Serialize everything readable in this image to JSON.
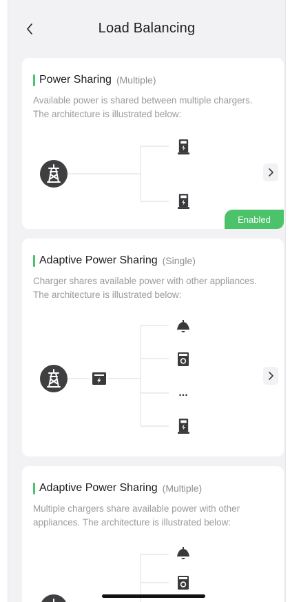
{
  "header": {
    "title": "Load Balancing",
    "back_icon": "chevron-left-icon"
  },
  "accent_color": "#4cc36b",
  "cards": [
    {
      "title": "Power Sharing",
      "subtitle": "(Multiple)",
      "description": "Available power is shared between multiple chargers. The architecture is illustrated below:",
      "status_badge": "Enabled",
      "diagram_nodes": [
        "power-tower-icon",
        "ev-charger-icon",
        "ev-charger-icon"
      ]
    },
    {
      "title": "Adaptive Power Sharing",
      "subtitle": "(Single)",
      "description": "Charger shares available power with other appliances. The architecture is illustrated below:",
      "diagram_nodes": [
        "power-tower-icon",
        "meter-icon",
        "lamp-icon",
        "washing-machine-icon",
        "ellipsis",
        "ev-charger-icon"
      ],
      "ellipsis_text": "..."
    },
    {
      "title": "Adaptive Power Sharing",
      "subtitle": "(Multiple)",
      "description": "Multiple chargers share available power with other appliances. The architecture is illustrated below:",
      "diagram_nodes": [
        "power-tower-icon",
        "lamp-icon",
        "washing-machine-icon"
      ]
    }
  ]
}
